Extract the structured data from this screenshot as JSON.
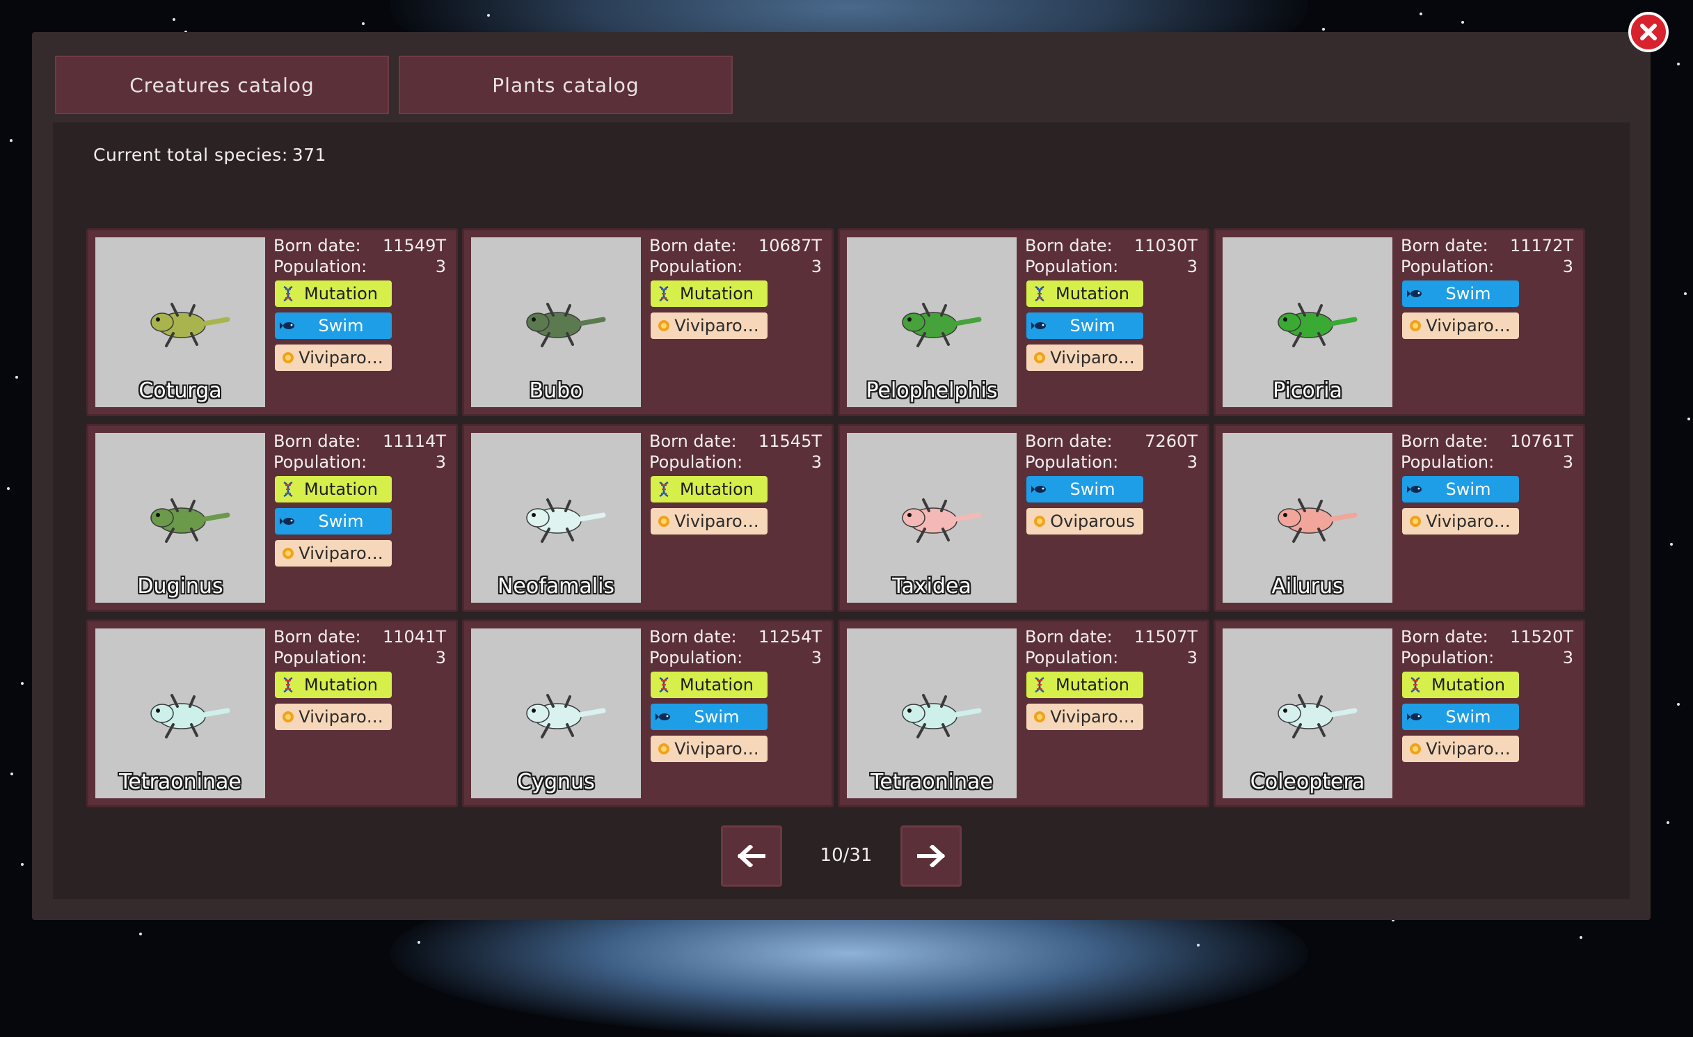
{
  "tabs": [
    {
      "label": "Creatures catalog"
    },
    {
      "label": "Plants catalog"
    }
  ],
  "summary": {
    "label": "Current total species:",
    "count": "371"
  },
  "labels": {
    "born": "Born date:",
    "population": "Population:"
  },
  "creatures": [
    {
      "name": "Coturga",
      "born": "11549T",
      "population": "3",
      "color": "#a9b44f",
      "traits": [
        "Mutation",
        "Swim",
        "Viviparo…"
      ]
    },
    {
      "name": "Bubo",
      "born": "10687T",
      "population": "3",
      "color": "#5c7a50",
      "traits": [
        "Mutation",
        "Viviparo…"
      ]
    },
    {
      "name": "Pelophelphis",
      "born": "11030T",
      "population": "3",
      "color": "#46a23a",
      "traits": [
        "Mutation",
        "Swim",
        "Viviparo…"
      ]
    },
    {
      "name": "Picoria",
      "born": "11172T",
      "population": "3",
      "color": "#3aaa34",
      "traits": [
        "Swim",
        "Viviparo…"
      ]
    },
    {
      "name": "Duginus",
      "born": "11114T",
      "population": "3",
      "color": "#6a9a4a",
      "traits": [
        "Mutation",
        "Swim",
        "Viviparo…"
      ]
    },
    {
      "name": "Neofamalis",
      "born": "11545T",
      "population": "3",
      "color": "#dff3f1",
      "traits": [
        "Mutation",
        "Viviparo…"
      ]
    },
    {
      "name": "Taxidea",
      "born": "7260T",
      "population": "3",
      "color": "#f4b9b6",
      "traits": [
        "Swim",
        "Oviparous"
      ]
    },
    {
      "name": "Ailurus",
      "born": "10761T",
      "population": "3",
      "color": "#f2a59a",
      "traits": [
        "Swim",
        "Viviparo…"
      ]
    },
    {
      "name": "Tetraoninae",
      "born": "11041T",
      "population": "3",
      "color": "#cdf0ea",
      "traits": [
        "Mutation",
        "Viviparo…"
      ]
    },
    {
      "name": "Cygnus",
      "born": "11254T",
      "population": "3",
      "color": "#d9f2ef",
      "traits": [
        "Mutation",
        "Swim",
        "Viviparo…"
      ]
    },
    {
      "name": "Tetraoninae",
      "born": "11507T",
      "population": "3",
      "color": "#cdf0ea",
      "traits": [
        "Mutation",
        "Viviparo…"
      ]
    },
    {
      "name": "Coleoptera",
      "born": "11520T",
      "population": "3",
      "color": "#d6f0ee",
      "traits": [
        "Mutation",
        "Swim",
        "Viviparo…"
      ]
    }
  ],
  "pagination": {
    "indicator": "10/31"
  },
  "icons": {
    "close": "close-icon",
    "prev": "arrow-left-icon",
    "next": "arrow-right-icon",
    "mutation": "dna-icon",
    "swim": "fish-icon",
    "repro": "egg-icon"
  },
  "colors": {
    "card": "#5b3039",
    "mutation": "#d6ef4a",
    "swim": "#1d9ee6",
    "repro": "#f7d7b9",
    "close": "#d8232e"
  }
}
